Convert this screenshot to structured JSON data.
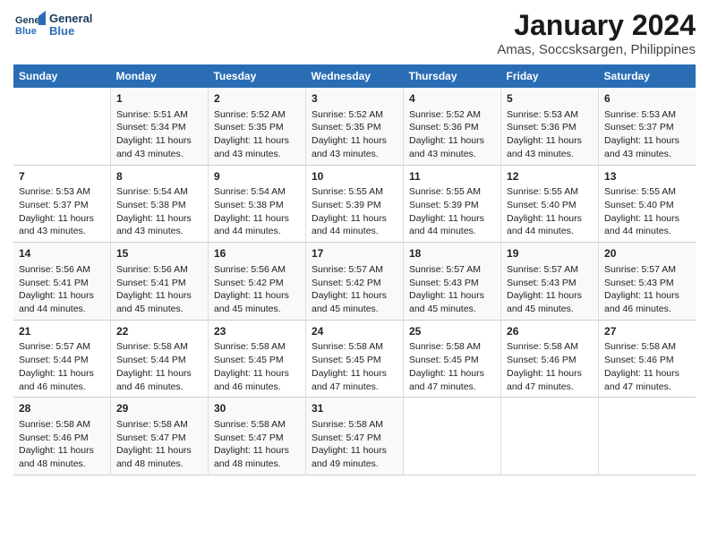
{
  "header": {
    "logo_line1": "General",
    "logo_line2": "Blue",
    "title": "January 2024",
    "subtitle": "Amas, Soccsksargen, Philippines"
  },
  "weekdays": [
    "Sunday",
    "Monday",
    "Tuesday",
    "Wednesday",
    "Thursday",
    "Friday",
    "Saturday"
  ],
  "weeks": [
    [
      {
        "day": "",
        "info": ""
      },
      {
        "day": "1",
        "info": "Sunrise: 5:51 AM\nSunset: 5:34 PM\nDaylight: 11 hours\nand 43 minutes."
      },
      {
        "day": "2",
        "info": "Sunrise: 5:52 AM\nSunset: 5:35 PM\nDaylight: 11 hours\nand 43 minutes."
      },
      {
        "day": "3",
        "info": "Sunrise: 5:52 AM\nSunset: 5:35 PM\nDaylight: 11 hours\nand 43 minutes."
      },
      {
        "day": "4",
        "info": "Sunrise: 5:52 AM\nSunset: 5:36 PM\nDaylight: 11 hours\nand 43 minutes."
      },
      {
        "day": "5",
        "info": "Sunrise: 5:53 AM\nSunset: 5:36 PM\nDaylight: 11 hours\nand 43 minutes."
      },
      {
        "day": "6",
        "info": "Sunrise: 5:53 AM\nSunset: 5:37 PM\nDaylight: 11 hours\nand 43 minutes."
      }
    ],
    [
      {
        "day": "7",
        "info": "Sunrise: 5:53 AM\nSunset: 5:37 PM\nDaylight: 11 hours\nand 43 minutes."
      },
      {
        "day": "8",
        "info": "Sunrise: 5:54 AM\nSunset: 5:38 PM\nDaylight: 11 hours\nand 43 minutes."
      },
      {
        "day": "9",
        "info": "Sunrise: 5:54 AM\nSunset: 5:38 PM\nDaylight: 11 hours\nand 44 minutes."
      },
      {
        "day": "10",
        "info": "Sunrise: 5:55 AM\nSunset: 5:39 PM\nDaylight: 11 hours\nand 44 minutes."
      },
      {
        "day": "11",
        "info": "Sunrise: 5:55 AM\nSunset: 5:39 PM\nDaylight: 11 hours\nand 44 minutes."
      },
      {
        "day": "12",
        "info": "Sunrise: 5:55 AM\nSunset: 5:40 PM\nDaylight: 11 hours\nand 44 minutes."
      },
      {
        "day": "13",
        "info": "Sunrise: 5:55 AM\nSunset: 5:40 PM\nDaylight: 11 hours\nand 44 minutes."
      }
    ],
    [
      {
        "day": "14",
        "info": "Sunrise: 5:56 AM\nSunset: 5:41 PM\nDaylight: 11 hours\nand 44 minutes."
      },
      {
        "day": "15",
        "info": "Sunrise: 5:56 AM\nSunset: 5:41 PM\nDaylight: 11 hours\nand 45 minutes."
      },
      {
        "day": "16",
        "info": "Sunrise: 5:56 AM\nSunset: 5:42 PM\nDaylight: 11 hours\nand 45 minutes."
      },
      {
        "day": "17",
        "info": "Sunrise: 5:57 AM\nSunset: 5:42 PM\nDaylight: 11 hours\nand 45 minutes."
      },
      {
        "day": "18",
        "info": "Sunrise: 5:57 AM\nSunset: 5:43 PM\nDaylight: 11 hours\nand 45 minutes."
      },
      {
        "day": "19",
        "info": "Sunrise: 5:57 AM\nSunset: 5:43 PM\nDaylight: 11 hours\nand 45 minutes."
      },
      {
        "day": "20",
        "info": "Sunrise: 5:57 AM\nSunset: 5:43 PM\nDaylight: 11 hours\nand 46 minutes."
      }
    ],
    [
      {
        "day": "21",
        "info": "Sunrise: 5:57 AM\nSunset: 5:44 PM\nDaylight: 11 hours\nand 46 minutes."
      },
      {
        "day": "22",
        "info": "Sunrise: 5:58 AM\nSunset: 5:44 PM\nDaylight: 11 hours\nand 46 minutes."
      },
      {
        "day": "23",
        "info": "Sunrise: 5:58 AM\nSunset: 5:45 PM\nDaylight: 11 hours\nand 46 minutes."
      },
      {
        "day": "24",
        "info": "Sunrise: 5:58 AM\nSunset: 5:45 PM\nDaylight: 11 hours\nand 47 minutes."
      },
      {
        "day": "25",
        "info": "Sunrise: 5:58 AM\nSunset: 5:45 PM\nDaylight: 11 hours\nand 47 minutes."
      },
      {
        "day": "26",
        "info": "Sunrise: 5:58 AM\nSunset: 5:46 PM\nDaylight: 11 hours\nand 47 minutes."
      },
      {
        "day": "27",
        "info": "Sunrise: 5:58 AM\nSunset: 5:46 PM\nDaylight: 11 hours\nand 47 minutes."
      }
    ],
    [
      {
        "day": "28",
        "info": "Sunrise: 5:58 AM\nSunset: 5:46 PM\nDaylight: 11 hours\nand 48 minutes."
      },
      {
        "day": "29",
        "info": "Sunrise: 5:58 AM\nSunset: 5:47 PM\nDaylight: 11 hours\nand 48 minutes."
      },
      {
        "day": "30",
        "info": "Sunrise: 5:58 AM\nSunset: 5:47 PM\nDaylight: 11 hours\nand 48 minutes."
      },
      {
        "day": "31",
        "info": "Sunrise: 5:58 AM\nSunset: 5:47 PM\nDaylight: 11 hours\nand 49 minutes."
      },
      {
        "day": "",
        "info": ""
      },
      {
        "day": "",
        "info": ""
      },
      {
        "day": "",
        "info": ""
      }
    ]
  ]
}
